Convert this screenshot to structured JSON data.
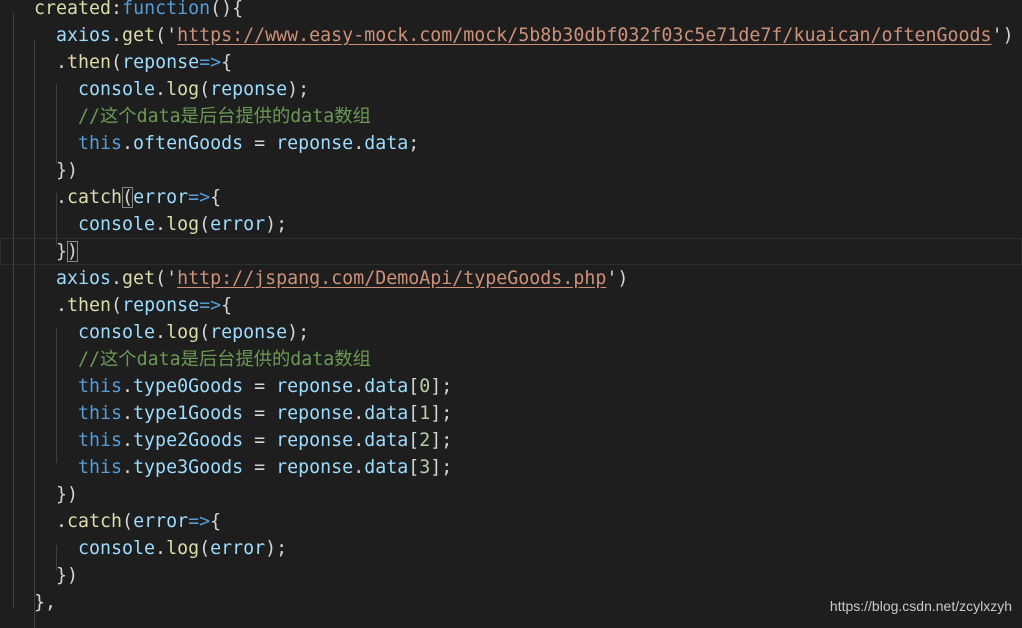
{
  "editor": {
    "theme": {
      "background": "#1e1e1e",
      "keyword": "#569cd6",
      "function": "#dcdcaa",
      "variable": "#9cdcfe",
      "string": "#ce9178",
      "number": "#b5cea8",
      "comment": "#6a9955",
      "punctuation": "#d4d4d4"
    },
    "lines": [
      {
        "tokens": [
          {
            "t": "created",
            "k": "fn"
          },
          {
            "t": ":",
            "k": "punc"
          },
          {
            "t": "function",
            "k": "kw"
          },
          {
            "t": "(){",
            "k": "punc"
          }
        ]
      },
      {
        "tokens": [
          {
            "t": "axios",
            "k": "var"
          },
          {
            "t": ".",
            "k": "punc"
          },
          {
            "t": "get",
            "k": "fn"
          },
          {
            "t": "('",
            "k": "punc"
          },
          {
            "t": "https://www.easy-mock.com/mock/5b8b30dbf032f03c5e71de7f/kuaican/oftenGoods",
            "k": "link"
          },
          {
            "t": "')",
            "k": "punc"
          }
        ]
      },
      {
        "tokens": [
          {
            "t": ".",
            "k": "punc"
          },
          {
            "t": "then",
            "k": "fn"
          },
          {
            "t": "(",
            "k": "punc"
          },
          {
            "t": "reponse",
            "k": "var"
          },
          {
            "t": "=>",
            "k": "kw"
          },
          {
            "t": "{",
            "k": "punc"
          }
        ]
      },
      {
        "tokens": [
          {
            "t": "console",
            "k": "var"
          },
          {
            "t": ".",
            "k": "punc"
          },
          {
            "t": "log",
            "k": "fn"
          },
          {
            "t": "(",
            "k": "punc"
          },
          {
            "t": "reponse",
            "k": "var"
          },
          {
            "t": ");",
            "k": "punc"
          }
        ]
      },
      {
        "tokens": [
          {
            "t": "//这个data是后台提供的data数组",
            "k": "cmt"
          }
        ]
      },
      {
        "tokens": [
          {
            "t": "this",
            "k": "kw"
          },
          {
            "t": ".",
            "k": "punc"
          },
          {
            "t": "oftenGoods",
            "k": "var"
          },
          {
            "t": " = ",
            "k": "punc"
          },
          {
            "t": "reponse",
            "k": "var"
          },
          {
            "t": ".",
            "k": "punc"
          },
          {
            "t": "data",
            "k": "var"
          },
          {
            "t": ";",
            "k": "punc"
          }
        ]
      },
      {
        "tokens": [
          {
            "t": "})",
            "k": "punc"
          }
        ]
      },
      {
        "tokens": [
          {
            "t": ".",
            "k": "punc"
          },
          {
            "t": "catch",
            "k": "fn"
          },
          {
            "t": "(",
            "k": "punc",
            "m": 1
          },
          {
            "t": "error",
            "k": "var"
          },
          {
            "t": "=>",
            "k": "kw"
          },
          {
            "t": "{",
            "k": "punc"
          }
        ]
      },
      {
        "tokens": [
          {
            "t": "console",
            "k": "var"
          },
          {
            "t": ".",
            "k": "punc"
          },
          {
            "t": "log",
            "k": "fn"
          },
          {
            "t": "(",
            "k": "punc"
          },
          {
            "t": "error",
            "k": "var"
          },
          {
            "t": ");",
            "k": "punc"
          }
        ]
      },
      {
        "tokens": [
          {
            "t": "}",
            "k": "punc"
          },
          {
            "t": ")",
            "k": "punc",
            "m": 1
          }
        ]
      },
      {
        "tokens": [
          {
            "t": "axios",
            "k": "var"
          },
          {
            "t": ".",
            "k": "punc"
          },
          {
            "t": "get",
            "k": "fn"
          },
          {
            "t": "('",
            "k": "punc"
          },
          {
            "t": "http://jspang.com/DemoApi/typeGoods.php",
            "k": "link"
          },
          {
            "t": "')",
            "k": "punc"
          }
        ]
      },
      {
        "tokens": [
          {
            "t": ".",
            "k": "punc"
          },
          {
            "t": "then",
            "k": "fn"
          },
          {
            "t": "(",
            "k": "punc"
          },
          {
            "t": "reponse",
            "k": "var"
          },
          {
            "t": "=>",
            "k": "kw"
          },
          {
            "t": "{",
            "k": "punc"
          }
        ]
      },
      {
        "tokens": [
          {
            "t": "console",
            "k": "var"
          },
          {
            "t": ".",
            "k": "punc"
          },
          {
            "t": "log",
            "k": "fn"
          },
          {
            "t": "(",
            "k": "punc"
          },
          {
            "t": "reponse",
            "k": "var"
          },
          {
            "t": ");",
            "k": "punc"
          }
        ]
      },
      {
        "tokens": [
          {
            "t": "//这个data是后台提供的data数组",
            "k": "cmt"
          }
        ]
      },
      {
        "tokens": [
          {
            "t": "this",
            "k": "kw"
          },
          {
            "t": ".",
            "k": "punc"
          },
          {
            "t": "type0Goods",
            "k": "var"
          },
          {
            "t": " = ",
            "k": "punc"
          },
          {
            "t": "reponse",
            "k": "var"
          },
          {
            "t": ".",
            "k": "punc"
          },
          {
            "t": "data",
            "k": "var"
          },
          {
            "t": "[",
            "k": "punc"
          },
          {
            "t": "0",
            "k": "num"
          },
          {
            "t": "];",
            "k": "punc"
          }
        ]
      },
      {
        "tokens": [
          {
            "t": "this",
            "k": "kw"
          },
          {
            "t": ".",
            "k": "punc"
          },
          {
            "t": "type1Goods",
            "k": "var"
          },
          {
            "t": " = ",
            "k": "punc"
          },
          {
            "t": "reponse",
            "k": "var"
          },
          {
            "t": ".",
            "k": "punc"
          },
          {
            "t": "data",
            "k": "var"
          },
          {
            "t": "[",
            "k": "punc"
          },
          {
            "t": "1",
            "k": "num"
          },
          {
            "t": "];",
            "k": "punc"
          }
        ]
      },
      {
        "tokens": [
          {
            "t": "this",
            "k": "kw"
          },
          {
            "t": ".",
            "k": "punc"
          },
          {
            "t": "type2Goods",
            "k": "var"
          },
          {
            "t": " = ",
            "k": "punc"
          },
          {
            "t": "reponse",
            "k": "var"
          },
          {
            "t": ".",
            "k": "punc"
          },
          {
            "t": "data",
            "k": "var"
          },
          {
            "t": "[",
            "k": "punc"
          },
          {
            "t": "2",
            "k": "num"
          },
          {
            "t": "];",
            "k": "punc"
          }
        ]
      },
      {
        "tokens": [
          {
            "t": "this",
            "k": "kw"
          },
          {
            "t": ".",
            "k": "punc"
          },
          {
            "t": "type3Goods",
            "k": "var"
          },
          {
            "t": " = ",
            "k": "punc"
          },
          {
            "t": "reponse",
            "k": "var"
          },
          {
            "t": ".",
            "k": "punc"
          },
          {
            "t": "data",
            "k": "var"
          },
          {
            "t": "[",
            "k": "punc"
          },
          {
            "t": "3",
            "k": "num"
          },
          {
            "t": "];",
            "k": "punc"
          }
        ]
      },
      {
        "tokens": [
          {
            "t": "})",
            "k": "punc"
          }
        ]
      },
      {
        "tokens": [
          {
            "t": ".",
            "k": "punc"
          },
          {
            "t": "catch",
            "k": "fn"
          },
          {
            "t": "(",
            "k": "punc"
          },
          {
            "t": "error",
            "k": "var"
          },
          {
            "t": "=>",
            "k": "kw"
          },
          {
            "t": "{",
            "k": "punc"
          }
        ]
      },
      {
        "tokens": [
          {
            "t": "console",
            "k": "var"
          },
          {
            "t": ".",
            "k": "punc"
          },
          {
            "t": "log",
            "k": "fn"
          },
          {
            "t": "(",
            "k": "punc"
          },
          {
            "t": "error",
            "k": "var"
          },
          {
            "t": ");",
            "k": "punc"
          }
        ]
      },
      {
        "tokens": [
          {
            "t": "})",
            "k": "punc"
          }
        ]
      },
      {
        "tokens": [
          {
            "t": "},",
            "k": "punc"
          }
        ]
      }
    ]
  },
  "watermark": {
    "text": "https://blog.csdn.net/zcylxzyh"
  }
}
